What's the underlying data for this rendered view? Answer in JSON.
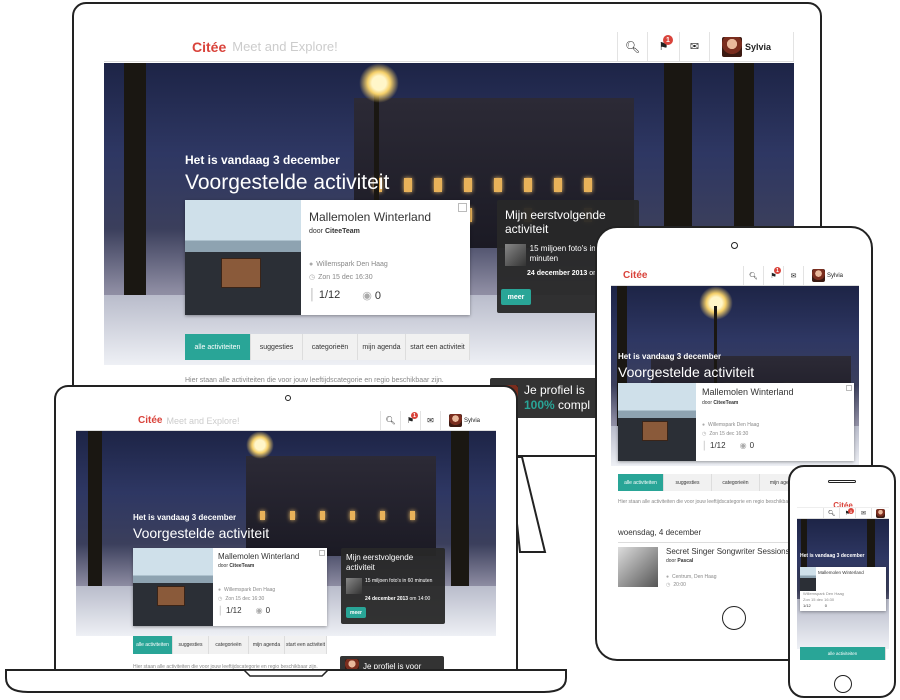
{
  "app": {
    "logo": "Citée",
    "tagline": "Meet and Explore!",
    "user_name": "Sylvia",
    "notification_count": "1"
  },
  "hero": {
    "date_text": "Het is vandaag 3 december",
    "heading": "Voorgestelde activiteit"
  },
  "suggested": {
    "title": "Mallemolen Winterland",
    "by_prefix": "door",
    "by_name": "CiteeTeam",
    "location": "Willemspark Den Haag",
    "datetime": "Zon 15 dec 16:30",
    "participants": "1/12",
    "views": "0"
  },
  "next_activity": {
    "heading": "Mijn eerstvolgende activiteit",
    "item_title": "15 miljoen foto's in 60 minuten",
    "item_date": "24 december 2013",
    "item_time_prefix": "om",
    "item_time": "14:00",
    "more_label": "meer"
  },
  "profile": {
    "text_desktop": "Je profiel is",
    "percent": "100%",
    "complete": "compl",
    "text_laptop": "Je profiel is voor"
  },
  "tabs": [
    "alle activiteiten",
    "suggesties",
    "categorieën",
    "mijn agenda",
    "start een activiteit"
  ],
  "intro_text": "Hier staan alle activiteiten die voor jouw leeftijdscategorie en regio beschikbaar zijn.",
  "tablet": {
    "intro_text": "Hier staan alle activiteiten die voor jouw leeftijdscategorie en regio beschikba",
    "day_heading": "woensdag, 4 december",
    "event_title": "Secret Singer Songwriter Sessions",
    "event_by": "Pascal",
    "event_location": "Centrum, Den Haag",
    "event_time": "20:00"
  },
  "phone": {
    "hero_text": "Het is vandaag 3 december",
    "tab_label": "alle activiteiten"
  },
  "colors": {
    "brand": "#d9433b",
    "accent": "#29a597",
    "dark_card": "#282828"
  }
}
